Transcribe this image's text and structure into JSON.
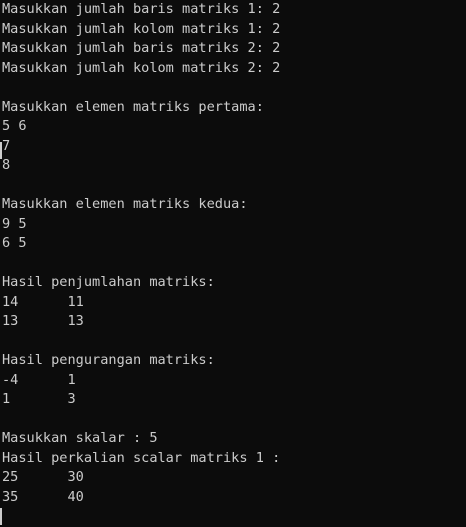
{
  "console": {
    "lines": [
      "Masukkan jumlah baris matriks 1: 2",
      "Masukkan jumlah kolom matriks 1: 2",
      "Masukkan jumlah baris matriks 2: 2",
      "Masukkan jumlah kolom matriks 2: 2",
      "",
      "Masukkan elemen matriks pertama:",
      "5 6",
      "7",
      "8",
      "",
      "Masukkan elemen matriks kedua:",
      "9 5",
      "6 5",
      "",
      "Hasil penjumlahan matriks:",
      "14      11",
      "13      13",
      "",
      "Hasil pengurangan matriks:",
      "-4      1",
      "1       3",
      "",
      "Masukkan skalar : 5",
      "Hasil perkalian scalar matriks 1 :",
      "25      30",
      "35      40"
    ]
  },
  "colors": {
    "background": "#0c0c0c",
    "text": "#cccccc"
  }
}
